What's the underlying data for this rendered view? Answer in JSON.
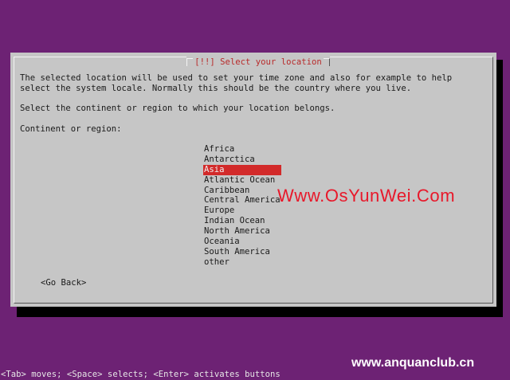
{
  "dialog": {
    "title": "[!!] Select your location",
    "description": "The selected location will be used to set your time zone and also for example to help\nselect the system locale. Normally this should be the country where you live.",
    "prompt": "Select the continent or region to which your location belongs.",
    "field_label": "Continent or region:",
    "regions": [
      "Africa",
      "Antarctica",
      "Asia",
      "Atlantic Ocean",
      "Caribbean",
      "Central America",
      "Europe",
      "Indian Ocean",
      "North America",
      "Oceania",
      "South America",
      "other"
    ],
    "selected_region": "Asia",
    "go_back_label": "<Go Back>"
  },
  "status_bar": {
    "text": "<Tab> moves; <Space> selects; <Enter> activates buttons"
  },
  "watermarks": {
    "center": "Www.OsYunWei.Com",
    "bottom": "www.anquanclub.cn"
  },
  "colors": {
    "background": "#6d2274",
    "dialog": "#c6c6c6",
    "title_text": "#b82a2a",
    "selection": "#d22a2a",
    "watermark_center": "#e8182a"
  }
}
